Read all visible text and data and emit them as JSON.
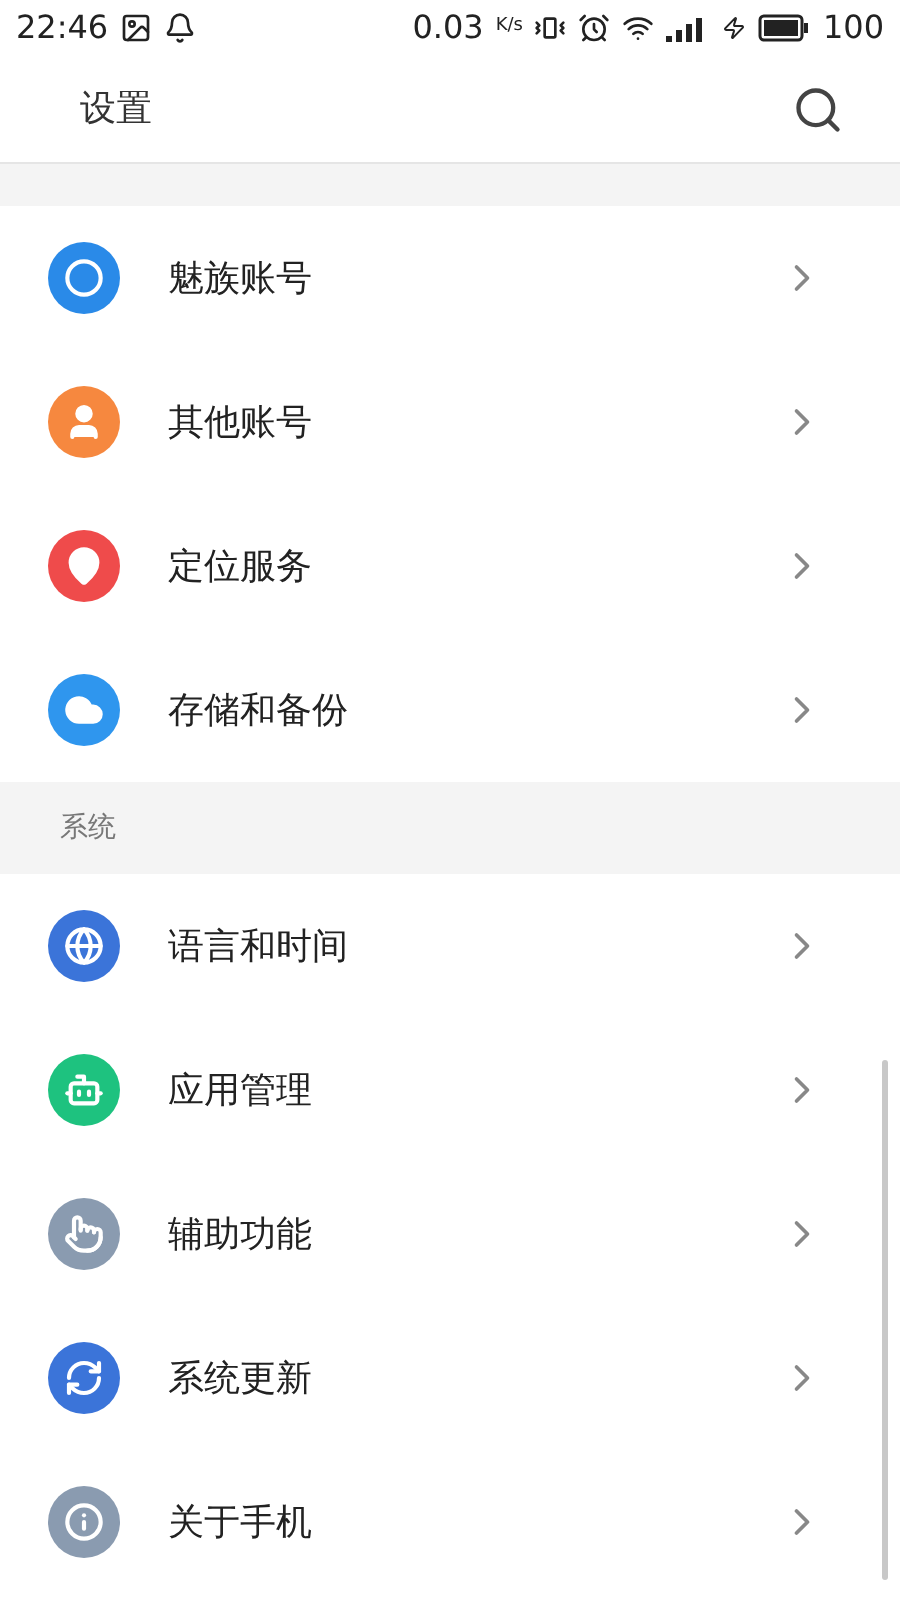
{
  "status_bar": {
    "time": "22:46",
    "speed": "0.03",
    "speed_unit": "K/s",
    "battery": "100"
  },
  "header": {
    "title": "设置"
  },
  "sections": [
    {
      "items": [
        {
          "label": "魅族账号",
          "color": "#2a8ae8"
        },
        {
          "label": "其他账号",
          "color": "#f6883f"
        },
        {
          "label": "定位服务",
          "color": "#ef4b4b"
        },
        {
          "label": "存储和备份",
          "color": "#2f96ee"
        }
      ]
    },
    {
      "title": "系统",
      "items": [
        {
          "label": "语言和时间",
          "color": "#3b74d9"
        },
        {
          "label": "应用管理",
          "color": "#1ec27f"
        },
        {
          "label": "辅助功能",
          "color": "#8a9bb0"
        },
        {
          "label": "系统更新",
          "color": "#3b74d9"
        },
        {
          "label": "关于手机",
          "color": "#8a9bb0"
        }
      ]
    }
  ]
}
